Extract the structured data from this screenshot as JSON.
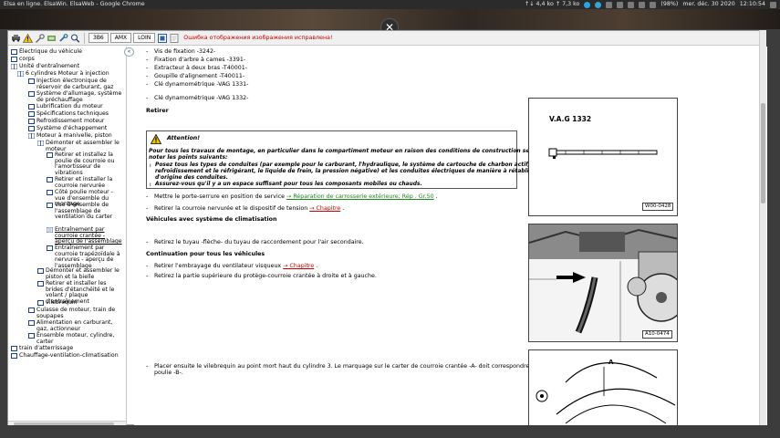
{
  "topbar": {
    "window_title": "Elsa en ligne. ElsaWin. ElsaWeb - Google Chrome",
    "network": "↑↓ 4,4 ko   ↑ 7,3 ko",
    "battery": "(98%)",
    "datetime": "mer. déc. 30 2020",
    "time": "12:10:54"
  },
  "overlay": {
    "close_glyph": "✕"
  },
  "toolbar": {
    "btn_3b6": "3B6",
    "btn_amx": "AMX",
    "btn_loin": "LOIN",
    "message": "Ошибка отображения изображения исправлена!"
  },
  "tree": {
    "items": [
      "Électrique du véhicule",
      "corps",
      "Unité d'entraînement",
      "6 cylindres Moteur à injection",
      "Injection électronique de réservoir de carburant, gaz",
      "Système d'allumage, système de préchauffage",
      "Lubrification du moteur",
      "Spécifications techniques",
      "Refroidissement moteur",
      "Système d'échappement",
      "Moteur à manivelle, piston",
      "Démonter et assembler le moteur",
      "Retirer et installez la poulie de courroie ou l'amortisseur de vibrations",
      "Retirer et installer la courroie nervurée",
      "Côté poulie moteur - vue d'ensemble du montage",
      "Vue d'ensemble de l'assemblage de ventilation du carter",
      "Entraînement par courroie crantée - aperçu de l'assemblage",
      "Entraînement par courroie trapézoïdale à nervures - aperçu de l'assemblage",
      "Démonter et assembler le piston et la bielle",
      "Retirer et installer les brides d'étanchéité et le volant / plaque d'entraînement",
      "vilebrequin",
      "Culasse de moteur, train de soupapes",
      "Alimentation en carburant, gaz, actionneur",
      "Ensemble moteur, cylindre, carter",
      "train d'atterrissage",
      "Chauffage-ventilation-climatisation"
    ]
  },
  "content": {
    "collapse_glyph": "«",
    "tools": [
      "Vis de fixation -3242-",
      "Fixation d'arbre à cames -3391-",
      "Extracteur à deux bras -T40001-",
      "Goupille d'alignement -T40011-",
      "Clé dynamométrique -VAG 1331-",
      "Clé dynamométrique -VAG 1332-"
    ],
    "retirer_heading": "Retirer",
    "warning": {
      "title": "Attention!",
      "intro_1": "Pour tous les travaux de montage, en particulier dans le compartiment moteur en raison des conditions de construction serrées, veuillez",
      "intro_2": "noter les points suivants:",
      "b1_1": "Posez tous les types de conduites (par exemple pour le carburant, l'hydraulique, le système de cartouche de charbon actif, le liquide de",
      "b1_2": "refroidissement et le réfrigérant, le liquide de frein, la pression négative) et les conduites électriques de manière à rétablir le tracé",
      "b1_3": "d'origine des conduites.",
      "b2": "Assurez-vous qu'il y a un espace suffisant pour tous les composants mobiles ou chauds."
    },
    "step1_text": "Mettre le porte-serrure en position de service",
    "step1_link": "→ Réparation de carrosserie extérieure; Rép . Gr.50",
    "step1_end": ".",
    "step2_text": "Retirer la courroie nervurée et le dispositif de tension",
    "step2_link": "→ Chapitre",
    "step2_end": ".",
    "heading_clim": "Véhicules avec système de climatisation",
    "step3": "Retirez le tuyau -flèche- du tuyau de raccordement pour l'air secondaire.",
    "heading_all": "Continuation pour tous les véhicules",
    "step4_text": "Retirer l'embrayage du ventilateur visqueux",
    "step4_link": "→ Chapitre",
    "step4_end": ".",
    "step5": "Retirez la partie supérieure du protège-courroie crantée à droite et à gauche.",
    "step6_1": "Placer ensuite le vilebrequin au point mort haut du cylindre 3. Le marquage sur le carter de courroie crantée -A- doit correspondre à l'encoche de la",
    "step6_2": "poulie -B-.",
    "fig1_title": "V.A.G 1332",
    "fig1_code": "W00-0428",
    "fig2_code": "A10-0474",
    "fig3_letter": "A",
    "bullet": "-"
  }
}
